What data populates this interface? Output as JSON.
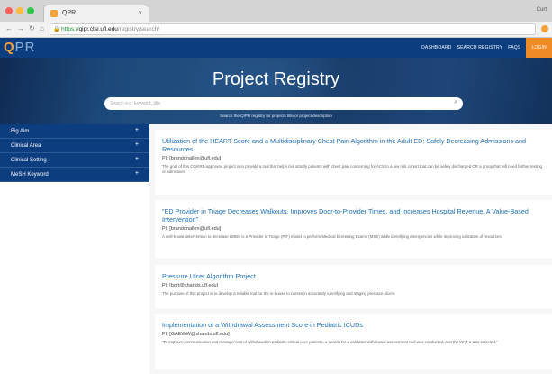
{
  "browser": {
    "tab_title": "QPR",
    "tab_close": "×",
    "user_name": "Curt",
    "url_scheme": "https://",
    "url_host": "qipr.ctsi.ufl.edu",
    "url_path": "/registry/search/",
    "traffic_colors": [
      "#fc605b",
      "#fdbc40",
      "#34c84a"
    ]
  },
  "site": {
    "logo_q": "Q",
    "logo_pr": "PR",
    "nav": [
      "DASHBOARD",
      "SEARCH REGISTRY",
      "FAQS"
    ],
    "login": "LOGIN",
    "brand_color": "#0c3d7f",
    "accent_color": "#f08a24"
  },
  "hero": {
    "title": "Project Registry",
    "search_placeholder": "Search e.g. keyword, title",
    "hint": "Search the QIPR registry for projects title or project description"
  },
  "sidebar": {
    "items": [
      {
        "label": "Big Aim",
        "chevron": "+"
      },
      {
        "label": "Clinical Area",
        "chevron": "+"
      },
      {
        "label": "Clinical Setting",
        "chevron": "+"
      },
      {
        "label": "MeSH Keyword",
        "chevron": "+"
      }
    ]
  },
  "results": [
    {
      "title": "Utilization of the HEART Score and a Multidisciplinary Chest Pain Algorithm in the Adult ED: Safely Decreasing Admissions and Resources",
      "pi": "PI: [brandonallen@ufl.edu]",
      "description": "The goal of this CQI/IRB-approved project is to provide a tool that helps risk stratify patients with chest pain concerning for ACS to a low risk cohort that can be safely discharged OR a group that will need further testing or admission."
    },
    {
      "title": "\"ED Provider in Triage Decreases Walkouts, Improves Door-to-Provider Times, and Increases Hospital Revenue: A Value-Based Intervention\"",
      "pi": "PI: [brandonallen@ufl.edu]",
      "description": "A well-known intervention to decrease LWBS is a Provider in Triage (PIT) model to perform Medical Screening Exams (MSE) while identifying emergencies while improving utilization of resources."
    },
    {
      "title": "Pressure Ulcer Algorithm Project",
      "pi": "PI: [bort@shands.ufl.edu]",
      "description": "The purpose of this project is to develop a reliable tool for the in-house to nurses in accurately identifying and staging pressure ulcers."
    },
    {
      "title": "Implementation of a Withdrawal Assessment Score in Pediatric ICUDs",
      "pi": "PI: [GAEWW@shands.ufl.edu]",
      "description": "\"To improve communication and management of withdrawal in pediatric critical care patients, a search for a validated withdrawal assessment tool was conducted, and the WAT-1 was selected.\""
    }
  ]
}
